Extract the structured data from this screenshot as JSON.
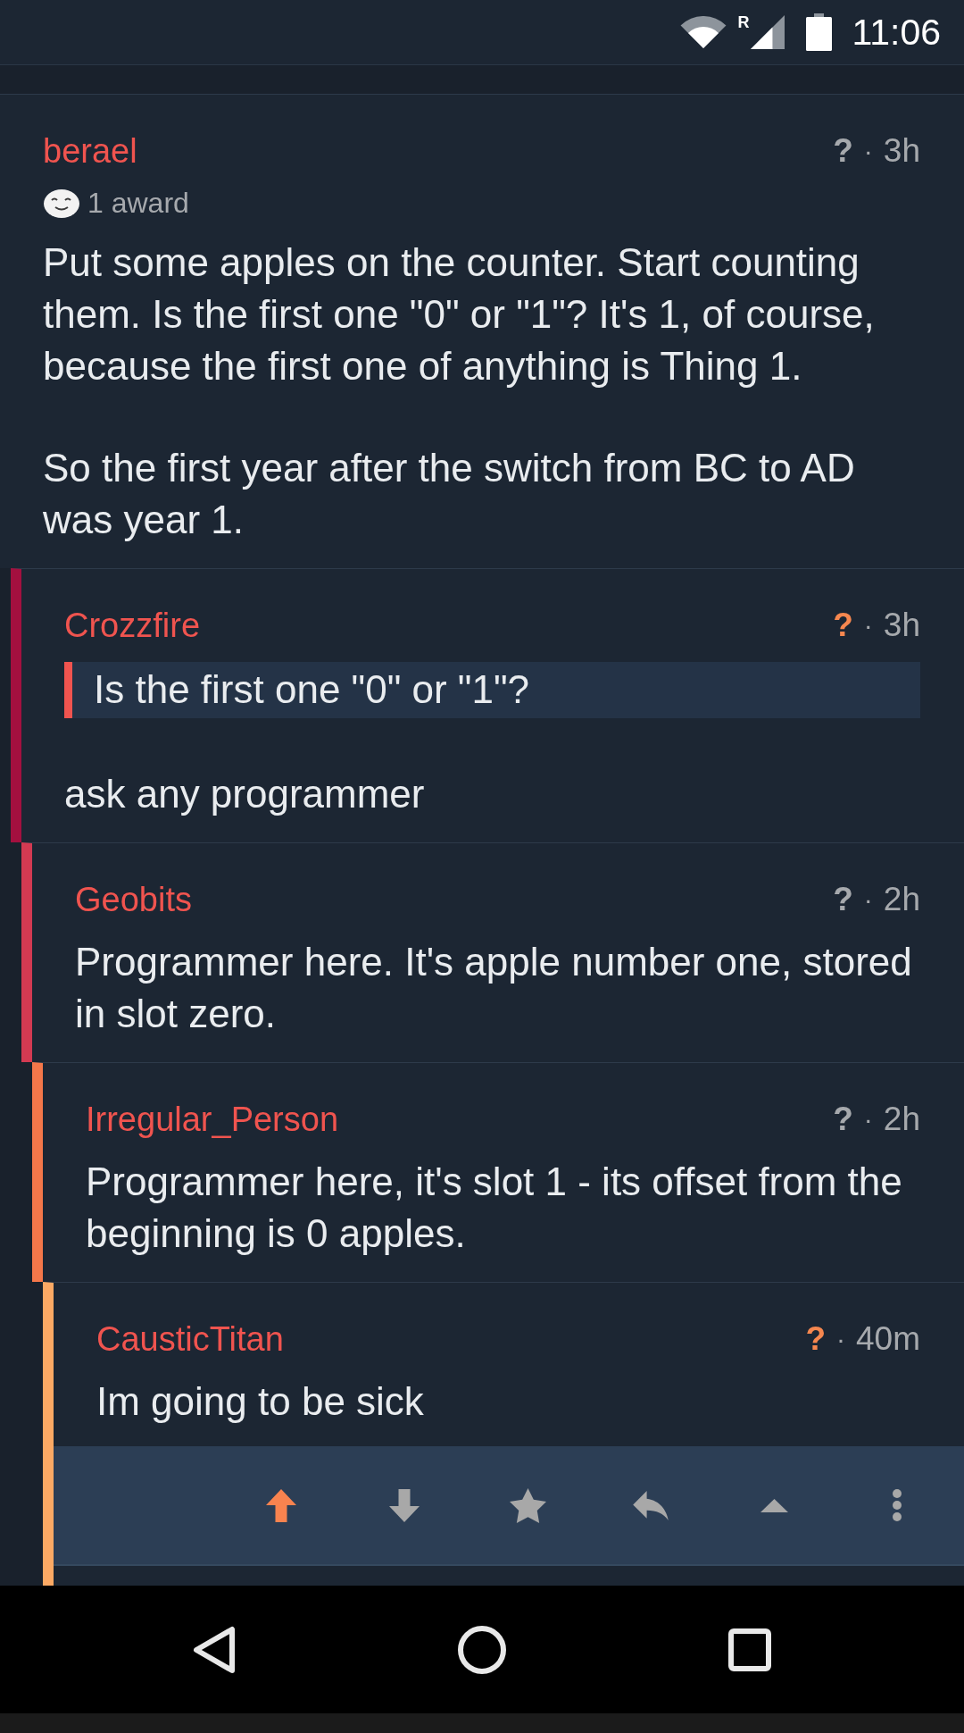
{
  "status_bar": {
    "network_label": "R",
    "time": "11:06"
  },
  "comments": [
    {
      "author": "berael",
      "score": "?",
      "separator": "·",
      "age": "3h",
      "upvoted": false,
      "selected": false,
      "award": "1 award",
      "body": [
        {
          "kind": "paragraph",
          "text": "Put some apples on the counter. Start counting them. Is the first one \"0\" or \"1\"? It's 1, of course, because the first one of anything is Thing 1."
        },
        {
          "kind": "paragraph",
          "text": "So the first year after the switch from BC to AD was year 1."
        }
      ],
      "children": [
        {
          "author": "Crozzfire",
          "score": "?",
          "separator": "·",
          "age": "3h",
          "upvoted": true,
          "selected": false,
          "body": [
            {
              "kind": "quote",
              "text": "Is the first one \"0\" or \"1\"?"
            },
            {
              "kind": "paragraph",
              "text": "ask any programmer"
            }
          ],
          "children": [
            {
              "author": "Geobits",
              "score": "?",
              "separator": "·",
              "age": "2h",
              "upvoted": false,
              "selected": false,
              "body": [
                {
                  "kind": "paragraph",
                  "text": "Programmer here. It's apple number one, stored in slot zero."
                }
              ],
              "children": [
                {
                  "author": "Irregular_Person",
                  "score": "?",
                  "separator": "·",
                  "age": "2h",
                  "upvoted": false,
                  "selected": false,
                  "body": [
                    {
                      "kind": "paragraph",
                      "text": "Programmer here, it's slot 1 - its offset from the beginning is 0 apples."
                    }
                  ],
                  "children": [
                    {
                      "author": "CausticTitan",
                      "score": "?",
                      "separator": "·",
                      "age": "40m",
                      "upvoted": true,
                      "selected": true,
                      "body": [
                        {
                          "kind": "paragraph",
                          "text": "Im going to be sick"
                        }
                      ]
                    }
                  ]
                }
              ]
            }
          ]
        }
      ]
    }
  ]
}
